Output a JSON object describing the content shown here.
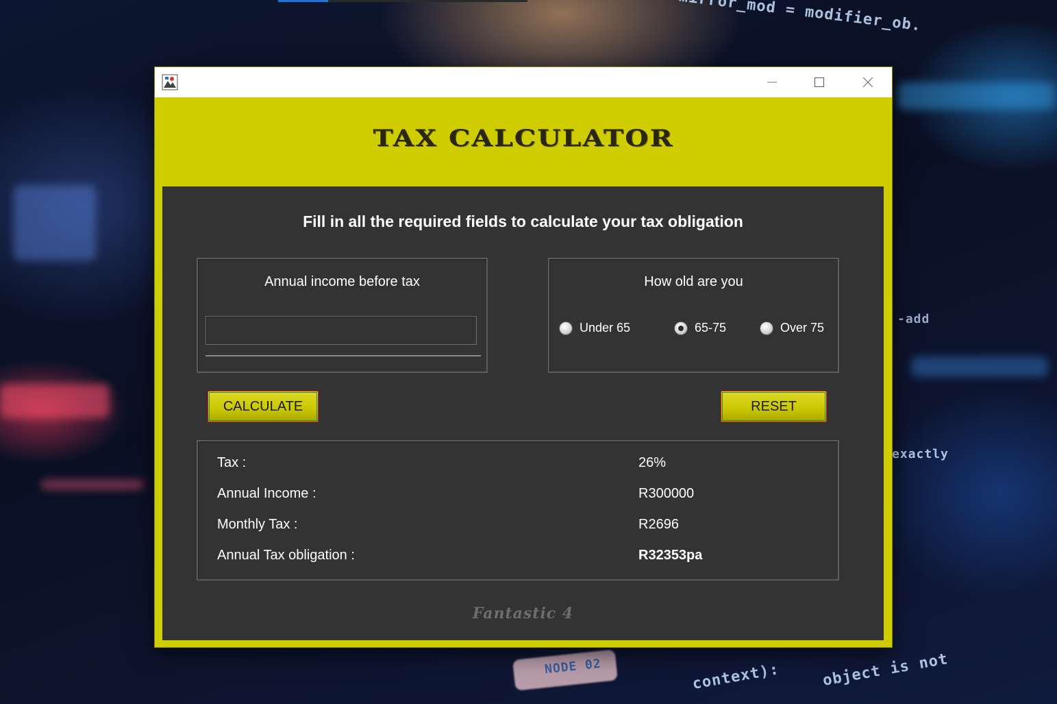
{
  "window": {
    "title": "",
    "app_title": "TAX CALCULATOR",
    "controls": {
      "minimize_icon": "minimize-icon",
      "maximize_icon": "maximize-icon",
      "close_icon": "close-icon"
    }
  },
  "form": {
    "instructions": "Fill in all the required fields to calculate your tax obligation",
    "income": {
      "label": "Annual income before tax",
      "value": "",
      "placeholder": ""
    },
    "age": {
      "label": "How old are you",
      "options": [
        "Under 65",
        "65-75",
        "Over 75"
      ],
      "selected": "65-75"
    },
    "buttons": {
      "calculate": "CALCULATE",
      "reset": "RESET"
    }
  },
  "results": {
    "tax_label": "Tax :",
    "tax_value": "26%",
    "annual_income_label": "Annual Income :",
    "annual_income_value": "R300000",
    "monthly_tax_label": "Monthly Tax :",
    "monthly_tax_value": "R2696",
    "annual_tax_label": "Annual Tax obligation :",
    "annual_tax_value": "R32353pa"
  },
  "footer": {
    "signature": "Fantastic 4"
  },
  "background_code": {
    "line1": "mirror_mod = modifier_ob.",
    "line2": "context):",
    "line3": "object is not",
    "line4": "NODE 02",
    "line5": "-add",
    "line6": "exactly"
  },
  "colors": {
    "accent": "#cfcc00",
    "panel": "#333333",
    "text": "#ffffff"
  }
}
